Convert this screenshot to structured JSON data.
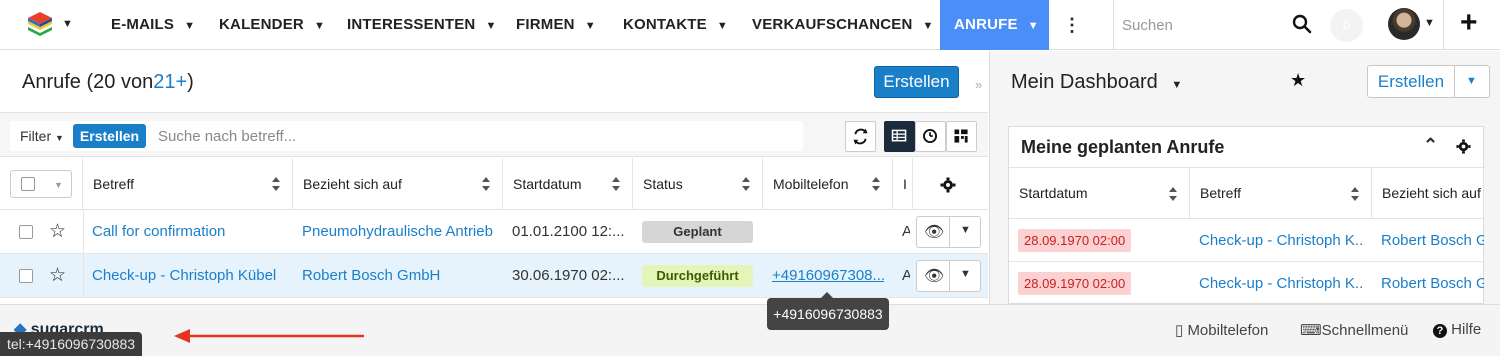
{
  "topnav": {
    "items": [
      {
        "label": "E-MAILS"
      },
      {
        "label": "KALENDER"
      },
      {
        "label": "INTERESSENTEN"
      },
      {
        "label": "FIRMEN"
      },
      {
        "label": "KONTAKTE"
      },
      {
        "label": "VERKAUFSCHANCEN"
      },
      {
        "label": "ANRUFE"
      }
    ],
    "active": "ANRUFE",
    "search_placeholder": "Suchen",
    "notification_count": "0",
    "accent_color": "#4c8ef7"
  },
  "list": {
    "title": "Anrufe",
    "count_prefix": "(20 von",
    "count_link": "21+",
    "count_suffix": ")",
    "create_label": "Erstellen",
    "filter_label": "Filter",
    "filter_create_label": "Erstellen",
    "search_placeholder": "Suche nach betreff...",
    "columns": [
      "Betreff",
      "Bezieht sich auf",
      "Startdatum",
      "Status",
      "Mobiltelefon"
    ],
    "rows": [
      {
        "subject": "Call for confirmation",
        "related": "Pneumohydraulische Antrieb",
        "start": "01.01.2100 12:...",
        "status": "Geplant",
        "mobile": ""
      },
      {
        "subject": "Check-up - Christoph Kübel",
        "related": "Robert Bosch GmbH",
        "start": "30.06.1970 02:...",
        "status": "Durchgeführt",
        "mobile": "+49160967308..."
      }
    ],
    "link_color": "#1a7fc9"
  },
  "dashboard": {
    "title": "Mein Dashboard",
    "create_label": "Erstellen",
    "dashlet": {
      "title": "Meine geplanten Anrufe",
      "columns": [
        "Startdatum",
        "Betreff",
        "Bezieht sich auf"
      ],
      "rows": [
        {
          "start": "28.09.1970 02:00",
          "subject": "Check-up - Christoph K...",
          "related": "Robert Bosch G"
        },
        {
          "start": "28.09.1970 02:00",
          "subject": "Check-up - Christoph K...",
          "related": "Robert Bosch G"
        }
      ]
    }
  },
  "footer": {
    "logo": "sugarcrm",
    "mobile_label": "Mobiltelefon",
    "shortcuts_label": "Schnellmenü",
    "help_label": "Hilfe"
  },
  "statusbar_url": "tel:+4916096730883",
  "hover_tooltip": "+4916096730883"
}
